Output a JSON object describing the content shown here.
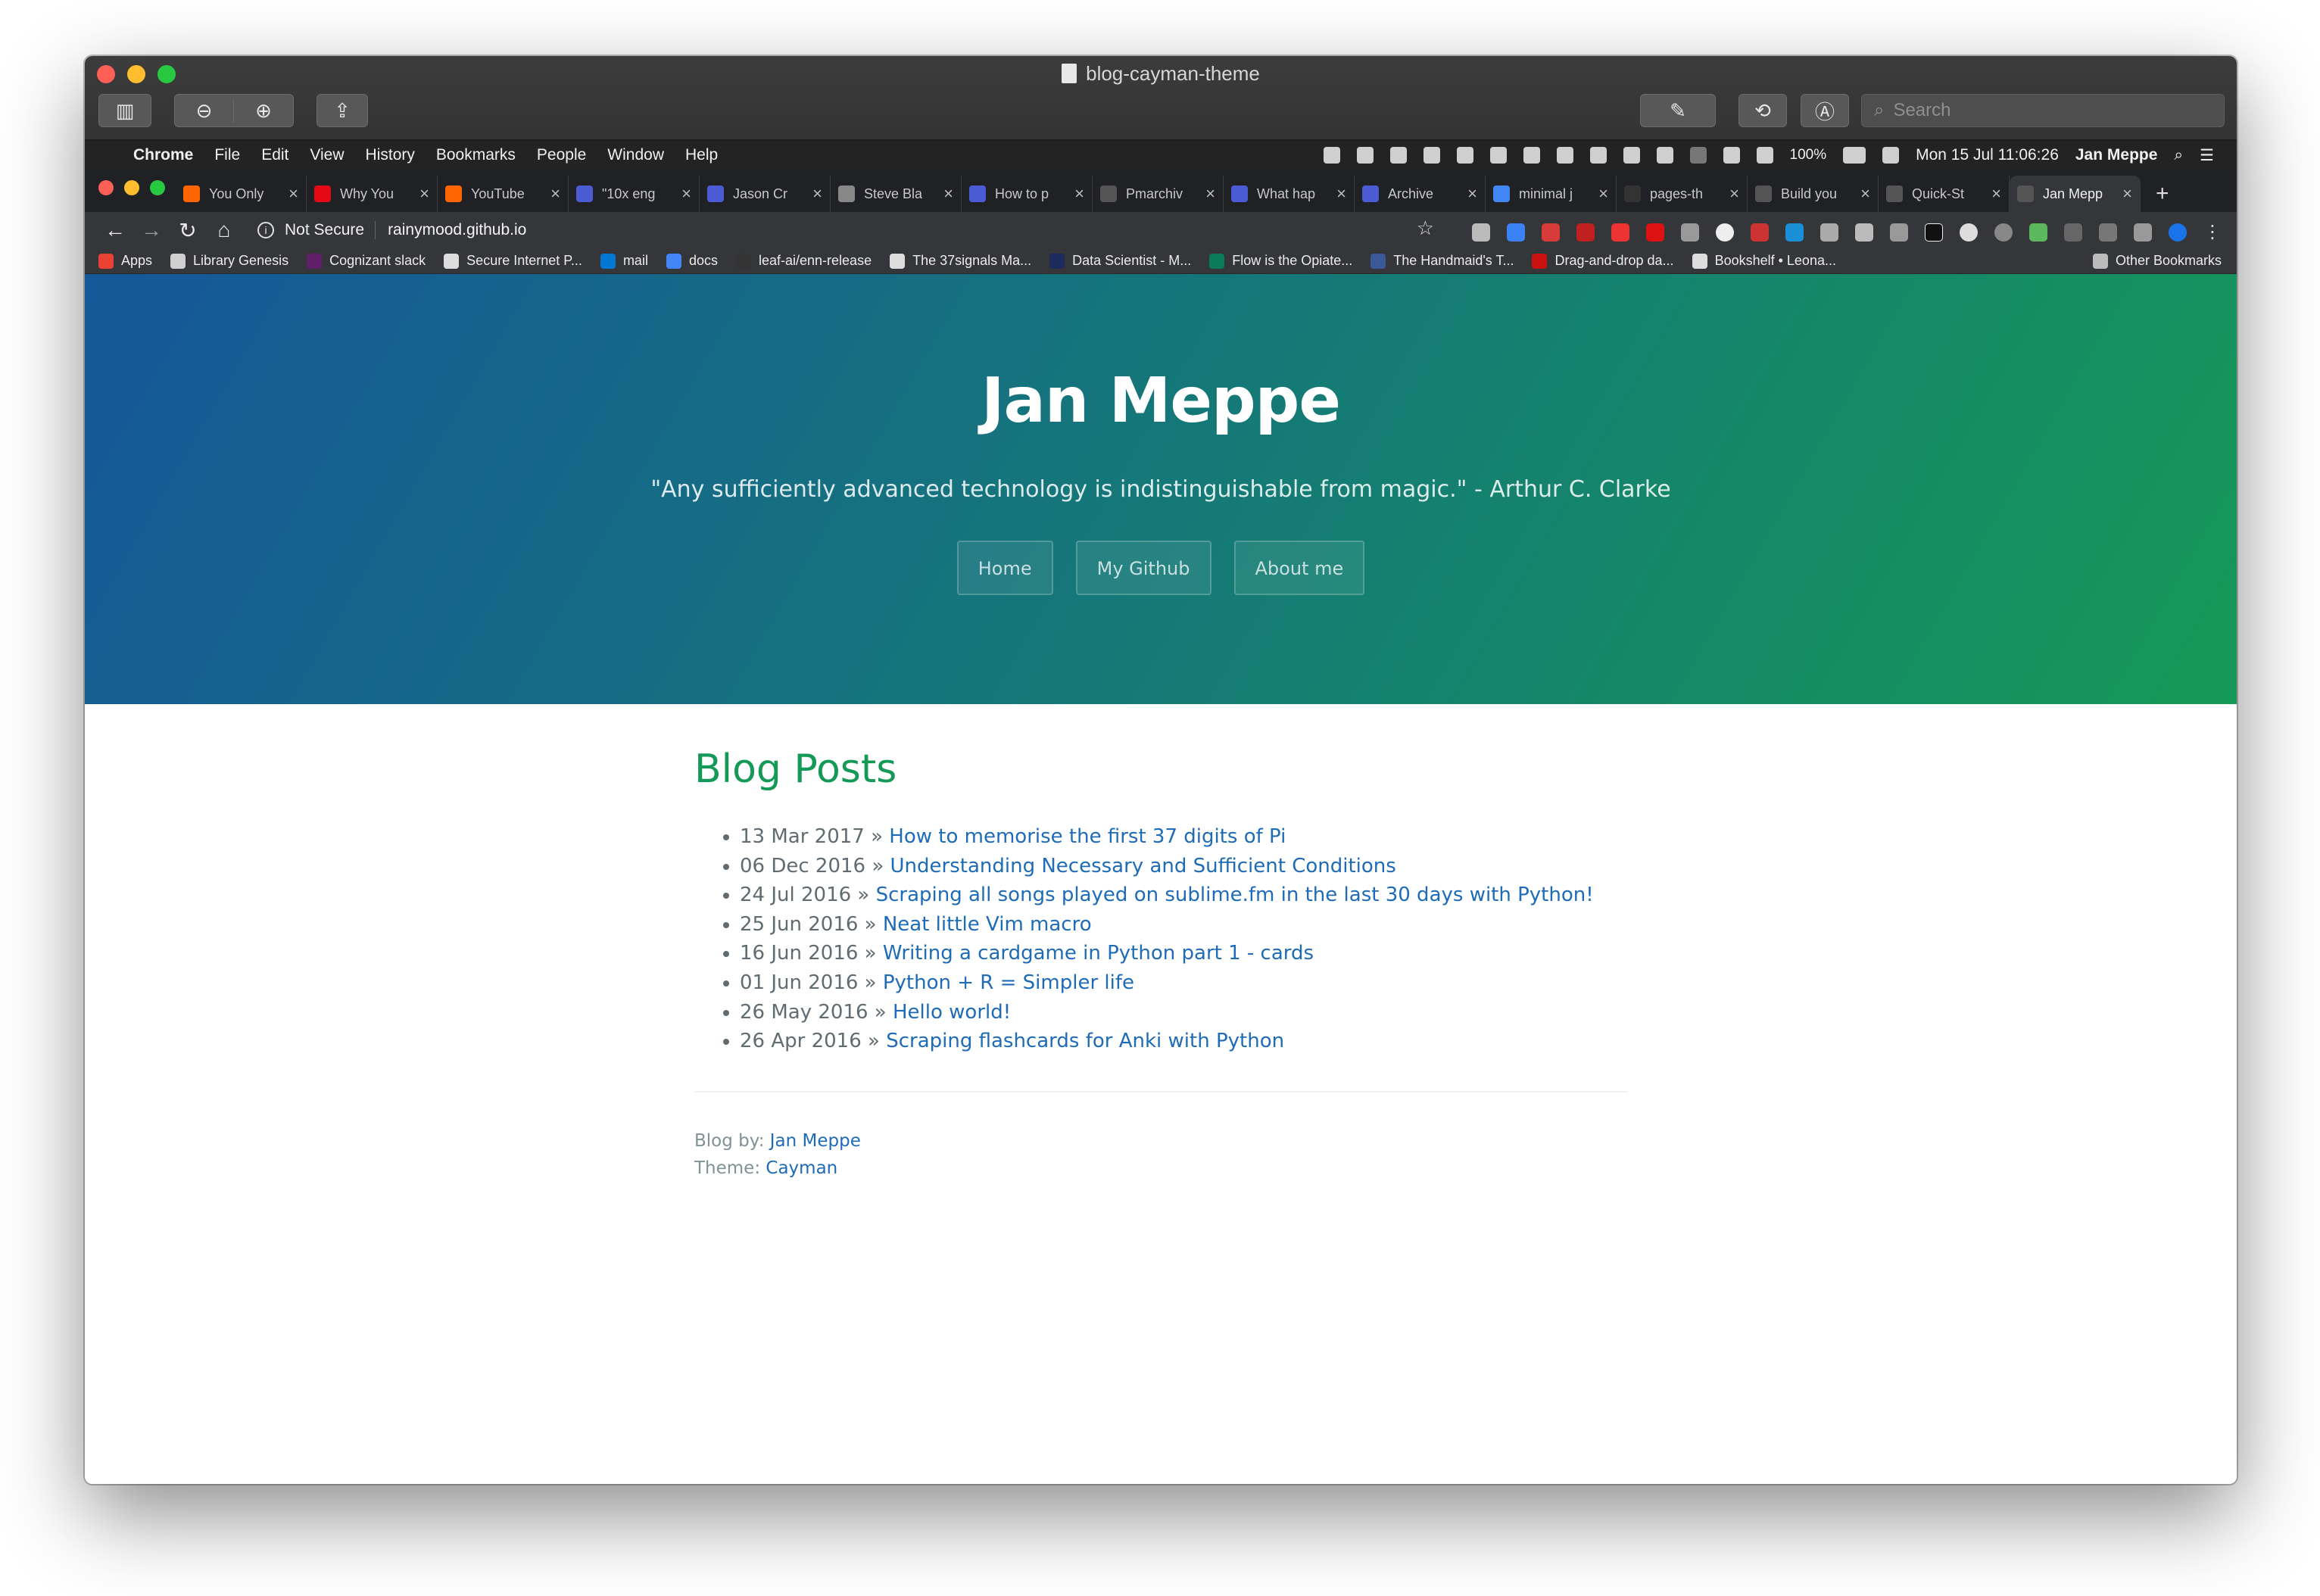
{
  "window_title": "blog-cayman-theme",
  "app_search_placeholder": "Search",
  "menubar": {
    "app": "Chrome",
    "items": [
      "File",
      "Edit",
      "View",
      "History",
      "Bookmarks",
      "People",
      "Window",
      "Help"
    ],
    "battery": "100%",
    "datetime": "Mon 15 Jul  11:06:26",
    "user": "Jan Meppe"
  },
  "tabs": [
    {
      "label": "You Only",
      "color": "#ff6600"
    },
    {
      "label": "Why You",
      "color": "#e50914"
    },
    {
      "label": "YouTube",
      "color": "#ff6600"
    },
    {
      "label": "\"10x eng",
      "color": "#4a5bd4"
    },
    {
      "label": "Jason Cr",
      "color": "#4a5bd4"
    },
    {
      "label": "Steve Bla",
      "color": "#888888"
    },
    {
      "label": "How to p",
      "color": "#4a5bd4"
    },
    {
      "label": "Pmarchiv",
      "color": "#555555"
    },
    {
      "label": "What hap",
      "color": "#4a5bd4"
    },
    {
      "label": "Archive",
      "color": "#4a5bd4"
    },
    {
      "label": "minimal j",
      "color": "#4285f4"
    },
    {
      "label": "pages-th",
      "color": "#333333"
    },
    {
      "label": "Build you",
      "color": "#555555"
    },
    {
      "label": "Quick-St",
      "color": "#555555"
    },
    {
      "label": "Jan Mepp",
      "color": "#555555"
    }
  ],
  "address_bar": {
    "security": "Not Secure",
    "url": "rainymood.github.io"
  },
  "bookmarks": [
    {
      "label": "Apps",
      "color": "#e94235"
    },
    {
      "label": "Library Genesis",
      "color": "#cfcfcf"
    },
    {
      "label": "Cognizant slack",
      "color": "#611f69"
    },
    {
      "label": "Secure Internet P...",
      "color": "#dddddd"
    },
    {
      "label": "mail",
      "color": "#0078d4"
    },
    {
      "label": "docs",
      "color": "#4285f4"
    },
    {
      "label": "leaf-ai/enn-release",
      "color": "#333333"
    },
    {
      "label": "The 37signals Ma...",
      "color": "#dddddd"
    },
    {
      "label": "Data Scientist - M...",
      "color": "#1c2a5c"
    },
    {
      "label": "Flow is the Opiate...",
      "color": "#0a7c5a"
    },
    {
      "label": "The Handmaid's T...",
      "color": "#3b5998"
    },
    {
      "label": "Drag-and-drop da...",
      "color": "#cc1111"
    },
    {
      "label": "Bookshelf • Leona...",
      "color": "#dddddd"
    }
  ],
  "other_bookmarks": "Other Bookmarks",
  "site": {
    "title": "Jan Meppe",
    "tagline": "\"Any sufficiently advanced technology is indistinguishable from magic.\" - Arthur C. Clarke",
    "nav": [
      "Home",
      "My Github",
      "About me"
    ],
    "section_title": "Blog Posts",
    "posts": [
      {
        "date": "13 Mar 2017",
        "title": "How to memorise the first 37 digits of Pi"
      },
      {
        "date": "06 Dec 2016",
        "title": "Understanding Necessary and Sufficient Conditions"
      },
      {
        "date": "24 Jul 2016",
        "title": "Scraping all songs played on sublime.fm in the last 30 days with Python!"
      },
      {
        "date": "25 Jun 2016",
        "title": "Neat little Vim macro"
      },
      {
        "date": "16 Jun 2016",
        "title": "Writing a cardgame in Python part 1 - cards"
      },
      {
        "date": "01 Jun 2016",
        "title": "Python + R = Simpler life"
      },
      {
        "date": "26 May 2016",
        "title": "Hello world!"
      },
      {
        "date": "26 Apr 2016",
        "title": "Scraping flashcards for Anki with Python"
      }
    ],
    "footer": {
      "blog_by_label": "Blog by:",
      "blog_by_link": "Jan Meppe",
      "theme_label": "Theme:",
      "theme_link": "Cayman"
    }
  },
  "colors": {
    "hero_start": "#155799",
    "hero_end": "#159957",
    "heading_green": "#159957",
    "link_blue": "#1e6bb8"
  }
}
